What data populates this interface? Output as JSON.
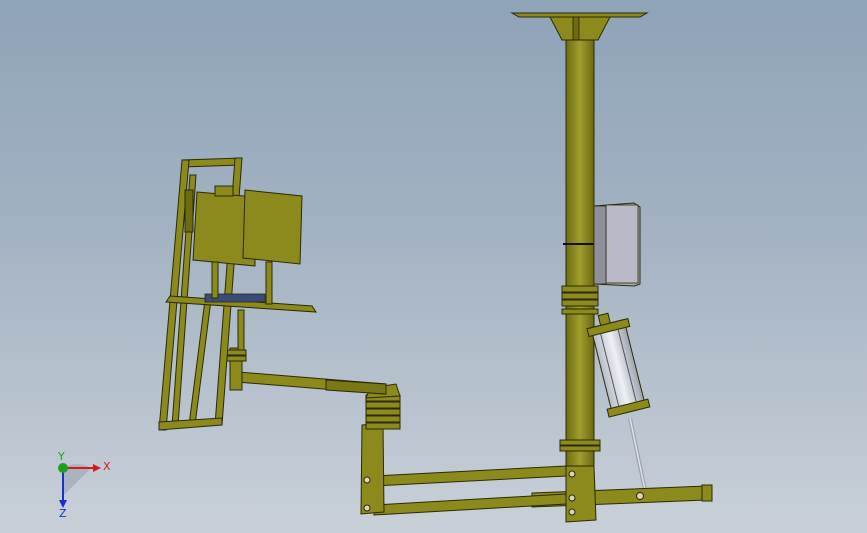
{
  "viewport": {
    "background_top": "#8fa3b8",
    "background_bottom": "#c9d0d8"
  },
  "model": {
    "body_color": "#8c8a1c",
    "edge_color": "#2a2a05",
    "panel_color": "#a8a8b6"
  },
  "triad": {
    "x_label": "X",
    "y_label": "Y",
    "z_label": "Z",
    "x_color": "#d11a1a",
    "y_color": "#1aa31a",
    "z_color": "#1a2fd1"
  }
}
